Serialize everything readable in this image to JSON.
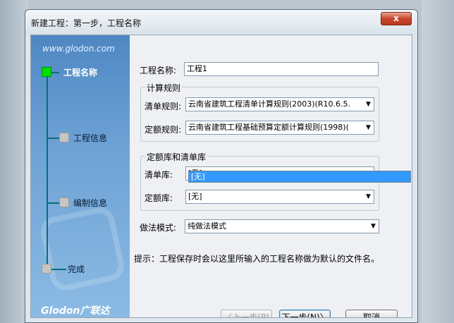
{
  "window": {
    "title": "新建工程：第一步，工程名称",
    "close_label": "x"
  },
  "sidebar": {
    "url": "www.glodon.com",
    "brand": "Glodon广联达",
    "steps": [
      {
        "label": "工程名称",
        "active": true
      },
      {
        "label": "工程信息",
        "active": false
      },
      {
        "label": "编制信息",
        "active": false
      },
      {
        "label": "完成",
        "active": false
      }
    ]
  },
  "form": {
    "project_name_label": "工程名称:",
    "project_name_value": "工程1",
    "calc_rules_group": "计算规则",
    "list_rule_label": "清单规则:",
    "list_rule_value": "云南省建筑工程清单计算规则(2003)(R10.6.5.",
    "quota_rule_label": "定额规则:",
    "quota_rule_value": "云南省建筑工程基础预算定额计算规则(1998)(",
    "library_group": "定额库和清单库",
    "list_lib_label": "清单库:",
    "list_lib_value": "[无]",
    "list_lib_dropdown_option": "[无]",
    "quota_lib_label": "定额库:",
    "quota_lib_value": "[无]",
    "method_label": "做法模式:",
    "method_value": "纯做法模式"
  },
  "hint": "提示：工程保存时会以这里所输入的工程名称做为默认的文件名。",
  "buttons": {
    "back": "〈上一步(P)",
    "next": "下一步(N)〉",
    "cancel": "取消"
  },
  "colors": {
    "sidebar_blue": "#5b93cb",
    "selection_blue": "#3399ff",
    "active_step_square": "#00e000"
  }
}
